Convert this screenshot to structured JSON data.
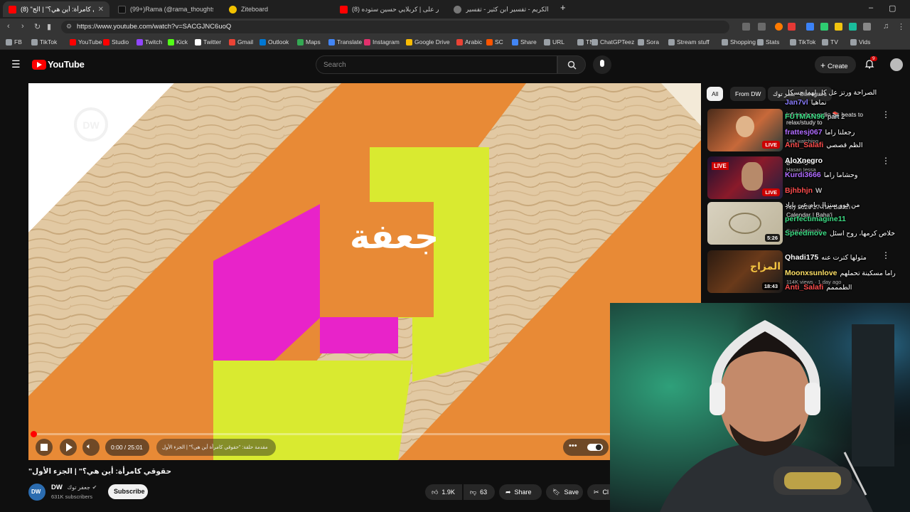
{
  "browser": {
    "tabs": [
      {
        "label": "(8) \"حقوقي كامرأة: أين هي؟\" | الج",
        "fav_color": "#ff0000",
        "active": true
      },
      {
        "label": "(99+)Rama (@rama_thoughts) | TikTo",
        "fav_color": "#111111",
        "active": false
      },
      {
        "label": "Ziteboard",
        "fav_color": "#f2c200",
        "active": false
      },
      {
        "label": "(8) تنار على | كربلايي حسين ستوده",
        "fav_color": "#ff0000",
        "active": false
      },
      {
        "label": "القرآن الكريم - تفسير ابن كثير - تفسير",
        "fav_color": "#777777",
        "active": false
      }
    ],
    "new_tab": "+",
    "window_controls": [
      "–",
      "▢",
      "✕"
    ],
    "url": "https://www.youtube.com/watch?v=SACGJNC6uoQ",
    "bookmarks": [
      {
        "label": "FB",
        "color": "#9aa0a6"
      },
      {
        "label": "TikTok",
        "color": "#9aa0a6"
      },
      {
        "label": "YouTube",
        "color": "#ff0000"
      },
      {
        "label": "Studio",
        "color": "#ff0000"
      },
      {
        "label": "Twitch",
        "color": "#9146ff"
      },
      {
        "label": "Kick",
        "color": "#53fc18"
      },
      {
        "label": "Twitter",
        "color": "#ffffff"
      },
      {
        "label": "Gmail",
        "color": "#ea4335"
      },
      {
        "label": "Outlook",
        "color": "#0078d4"
      },
      {
        "label": "Maps",
        "color": "#34a853"
      },
      {
        "label": "Translate",
        "color": "#4285f4"
      },
      {
        "label": "Instagram",
        "color": "#e1306c"
      },
      {
        "label": "Google Drive",
        "color": "#fbbc04"
      },
      {
        "label": "Arabic",
        "color": "#ea4335"
      },
      {
        "label": "SC",
        "color": "#ff5500"
      },
      {
        "label": "Share",
        "color": "#4285f4"
      },
      {
        "label": "URL",
        "color": "#9aa0a6"
      },
      {
        "label": "TN",
        "color": "#9aa0a6"
      },
      {
        "label": "ChatGPTeez",
        "color": "#9aa0a6"
      },
      {
        "label": "Sora",
        "color": "#9aa0a6"
      },
      {
        "label": "Stream stuff",
        "color": "#9aa0a6"
      },
      {
        "label": "Shopping",
        "color": "#9aa0a6"
      },
      {
        "label": "Stats",
        "color": "#9aa0a6"
      },
      {
        "label": "TikTok",
        "color": "#9aa0a6"
      },
      {
        "label": "TV",
        "color": "#9aa0a6"
      },
      {
        "label": "Vids",
        "color": "#9aa0a6"
      }
    ]
  },
  "youtube": {
    "logo": "YouTube",
    "search_placeholder": "Search",
    "create_label": "Create",
    "notification_count": "9",
    "chips": [
      "All",
      "From DW",
      "جعفر توك",
      "Dialogues"
    ],
    "video": {
      "time": "0:00 / 25:01",
      "progress": 0.0,
      "chapter": "مقدمة حلقة: \"حقوقي كامرأة أين هي؟\" | الجزء الأول",
      "title": "\"حقوقي كامرأة: أين هي؟\" | الجزء الأول",
      "channel": "DW",
      "channel_badge": "جعفر توك",
      "subscribers": "631K subscribers",
      "subscribe_label": "Subscribe",
      "likes": "1.9K",
      "dislikes": "63",
      "share_label": "Share",
      "save_label": "Save",
      "clip_label": "Cl"
    },
    "logo_overlay": "جعفة",
    "recommendations": [
      {
        "title": "lofi hip hop radio 📚 beats to relax/study to",
        "meta": "14K watching",
        "badge": "LIVE"
      },
      {
        "title": "دردشة مع",
        "meta": "Hasan Iessa",
        "badge": "LIVE"
      },
      {
        "title": "Ally 2026-27 The Baha'i Calendar | Baha'i",
        "meta": "Suraj Motiwala",
        "badge": "5:26"
      },
      {
        "title": "المزاج",
        "meta": "114K views · 1 day ago",
        "badge": "18:43"
      }
    ]
  },
  "chat": [
    {
      "user": "",
      "msg": "الصراحة ورتز عل كل لهما مسكل",
      "color": "#ffffff"
    },
    {
      "user": "Jan7vl",
      "msg": "نماهيا",
      "color": "#8a7cff"
    },
    {
      "user": "FUTMAN96",
      "msg": "part 2",
      "color": "#3ddc84"
    },
    {
      "user": "frattesj067",
      "msg": "رجعلنا راما",
      "color": "#b06cff"
    },
    {
      "user": "Anti_Salafi",
      "msg": "الظم قصصي",
      "color": "#ff4d4d"
    },
    {
      "user": "AloXnegro",
      "msg": "",
      "color": "#ffffff"
    },
    {
      "user": "Kurdi3666",
      "msg": "وحشاما راما",
      "color": "#b06cff"
    },
    {
      "user": "Bjhbhjn",
      "msg": "W",
      "color": "#ff4d4d"
    },
    {
      "user": "",
      "msg": "من فوو سنزال يام عي باياد",
      "color": "#ffffff"
    },
    {
      "user": "perfectimagine11",
      "msg": "",
      "color": "#3ddc84"
    },
    {
      "user": "Speedmove",
      "msg": "خلاص كرمها، روح اسئل",
      "color": "#3ddc84"
    },
    {
      "user": "Qhadi175",
      "msg": "مثولها كترت عنه",
      "color": "#ffffff"
    },
    {
      "user": "Moonxsunlove",
      "msg": "راما مسكينة تحملهم",
      "color": "#ffe066"
    },
    {
      "user": "Anti_Salafi",
      "msg": "الطمممم",
      "color": "#ff4d4d"
    }
  ]
}
